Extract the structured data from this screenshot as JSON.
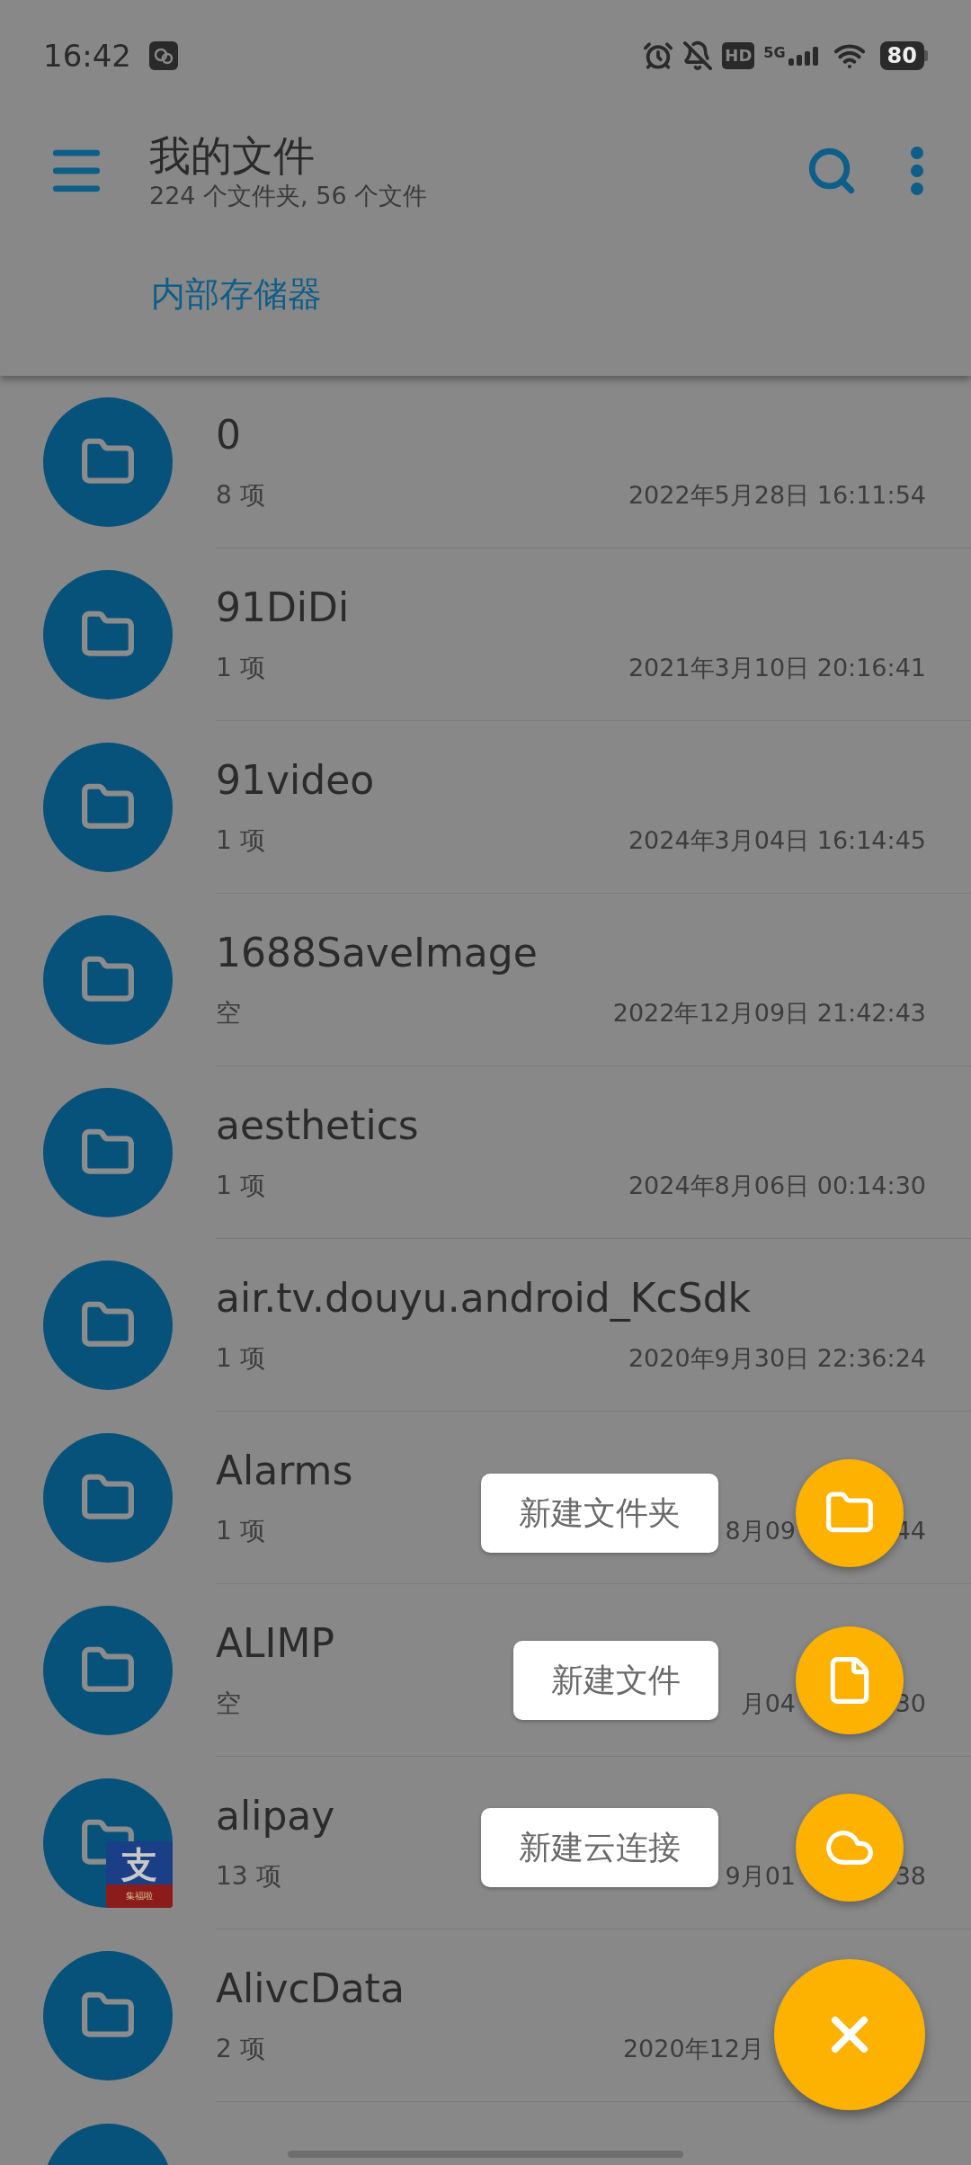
{
  "status_bar": {
    "time": "16:42",
    "hd": "HD",
    "network": "5G",
    "battery": "80"
  },
  "toolbar": {
    "title": "我的文件",
    "subtitle": "224 个文件夹, 56 个文件"
  },
  "breadcrumb": {
    "label": "内部存储器"
  },
  "files": [
    {
      "name": "0",
      "count": "8 项",
      "date_parts": [
        "2022年5月28日 16:11:54"
      ],
      "covered_end": false
    },
    {
      "name": "91DiDi",
      "count": "1 项",
      "date_parts": [
        "2021年3月10日 20:16:41"
      ],
      "covered_end": false
    },
    {
      "name": "91video",
      "count": "1 项",
      "date_parts": [
        "2024年3月04日 16:14:45"
      ],
      "covered_end": false
    },
    {
      "name": "1688SaveImage",
      "count": "空",
      "date_parts": [
        "2022年12月09日 21:42:43"
      ],
      "covered_end": false
    },
    {
      "name": "aesthetics",
      "count": "1 项",
      "date_parts": [
        "2024年8月06日 00:14:30"
      ],
      "covered_end": false
    },
    {
      "name": "air.tv.douyu.android_KcSdk",
      "count": "1 项",
      "date_parts": [
        "2020年9月30日 22:36:24"
      ],
      "covered_end": false
    },
    {
      "name": "Alarms",
      "count": "1 项",
      "date_parts": [
        "8月09",
        "44"
      ],
      "covered_end": false
    },
    {
      "name": "ALIMP",
      "count": "空",
      "date_parts": [
        "月04",
        "30"
      ],
      "covered_end": false
    },
    {
      "name": "alipay",
      "count": "13 项",
      "date_parts": [
        "9月01",
        "38"
      ],
      "covered_end": false,
      "badge": {
        "glyph": "支",
        "caption": "集福啦"
      }
    },
    {
      "name": "AlivcData",
      "count": "2 项",
      "date_parts": [
        "2020年12月"
      ],
      "covered_end": true
    }
  ],
  "fab_menu": [
    {
      "kind": "folder",
      "label": "新建文件夹"
    },
    {
      "kind": "file",
      "label": "新建文件"
    },
    {
      "kind": "cloud",
      "label": "新建云连接"
    }
  ]
}
